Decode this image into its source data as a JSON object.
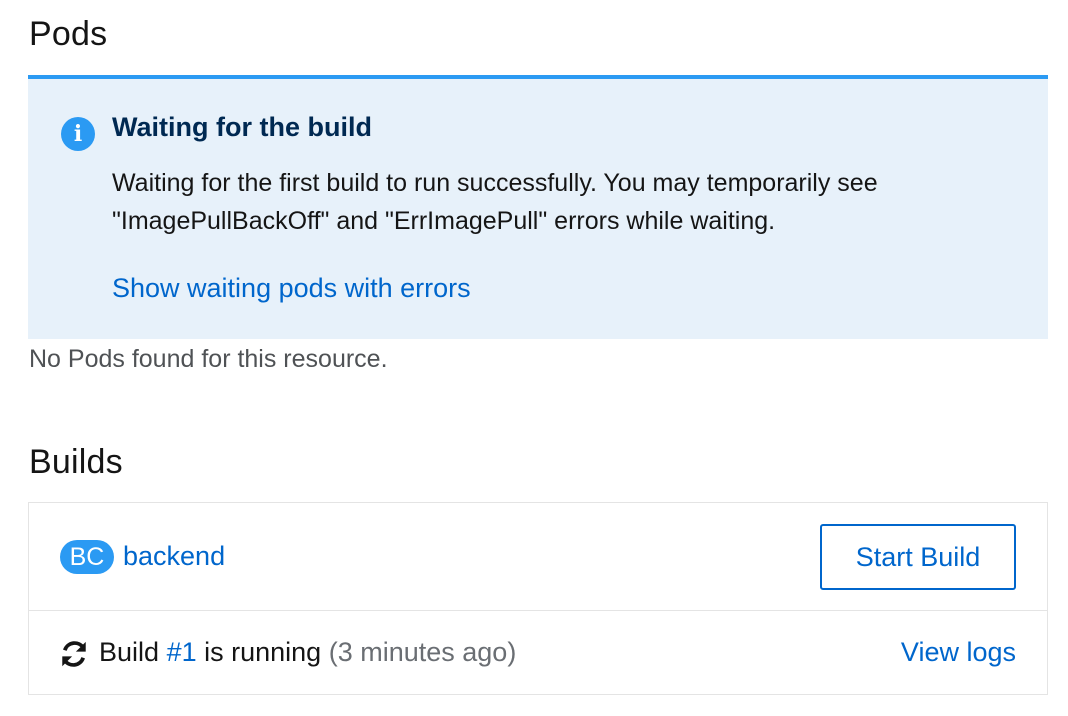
{
  "pods": {
    "title": "Pods",
    "alert": {
      "icon": "info-circle-icon",
      "title": "Waiting for the build",
      "body": "Waiting for the first build to run successfully. You may temporarily see \"ImagePullBackOff\" and \"ErrImagePull\" errors while waiting.",
      "link_label": "Show waiting pods with errors"
    },
    "empty_text": "No Pods found for this resource."
  },
  "builds": {
    "title": "Builds",
    "config": {
      "badge": "BC",
      "name": "backend",
      "start_label": "Start Build"
    },
    "latest": {
      "icon": "sync-icon",
      "prefix": "Build",
      "number": "#1",
      "status": "is running",
      "time": "(3 minutes ago)",
      "logs_label": "View logs"
    }
  },
  "colors": {
    "accent": "#0066cc",
    "info_blue": "#2b9af3",
    "alert_bg": "#e7f1fa",
    "alert_title": "#002952"
  }
}
